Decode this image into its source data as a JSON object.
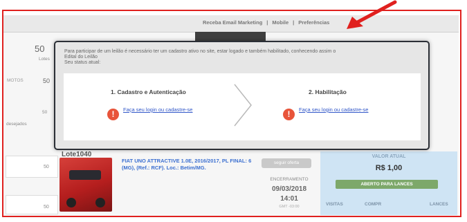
{
  "topbar": {
    "link_email": "Receba Email Marketing",
    "sep1": "|",
    "link_mobile": "Mobile",
    "sep2": "|",
    "link_prefs": "Preferências"
  },
  "sidebar": {
    "lotes_count": "50",
    "lotes_label": "Lotes",
    "veiculos_label": "MOTOS",
    "veiculos_count": "50",
    "desejados_count": "50",
    "desejados_label": "desejados",
    "box1_count": "50",
    "box2_count": "50"
  },
  "modal": {
    "intro_line1": "Para participar de um leilão é necessário ter um cadastro ativo no site, estar logado e também habilitado, conhecendo assim o",
    "intro_line2": "Edital do Leilão",
    "intro_line3": "Seu status atual:",
    "step1_title": "1. Cadastro e Autenticação",
    "step1_link": "Faça seu login ou cadastre-se",
    "step2_title": "2. Habilitação",
    "step2_link": "Faça seu login ou cadastre-se",
    "warn_glyph": "!"
  },
  "lot": {
    "title": "Lote1040",
    "description": "FIAT UNO ATTRACTIVE 1.0E, 2016/2017, PL FINAL: 6 (MG), (Ref.: RCF). Loc.: Betim/MG.",
    "follow_button": "seguir oferta",
    "closing_label": "ENCERRAMENTO",
    "closing_date": "09/03/2018",
    "closing_time": "14:01",
    "closing_tz": "GMT -03:00",
    "current_value_label": "VALOR ATUAL",
    "current_value": "R$ 1,00",
    "open_button": "ABERTO PARA LANCES",
    "stat_visits": "VISITAS",
    "stat_comp": "COMPR",
    "stat_bids": "LANCES"
  },
  "colors": {
    "annotation_red": "#e0201e",
    "link_blue": "#2f55c8",
    "warning_orange": "#e8543a",
    "value_panel": "#cfe4f4"
  }
}
